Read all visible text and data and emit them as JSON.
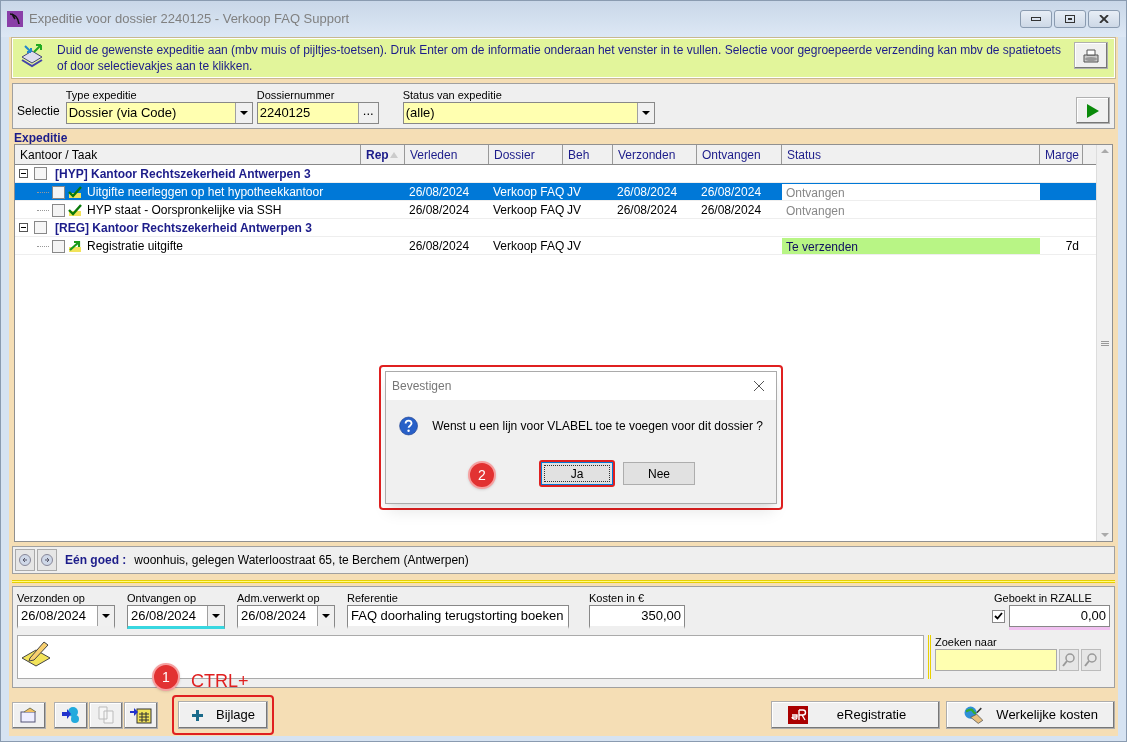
{
  "window": {
    "title": "Expeditie voor dossier 2240125 - Verkoop FAQ Support"
  },
  "info_bar": {
    "text": "Duid de gewenste expeditie aan (mbv muis of pijltjes-toetsen). Druk Enter om de informatie onderaan het venster in te vullen. Selectie voor gegroepeerde verzending kan mbv de spatietoets of door selectievakjes aan te klikken."
  },
  "selection": {
    "label": "Selectie",
    "fields": [
      {
        "label": "Type expeditie",
        "value": "Dossier (via Code)",
        "kind": "dropdown"
      },
      {
        "label": "Dossiernummer",
        "value": "2240125",
        "kind": "lookup",
        "button": "..."
      },
      {
        "label": "Status van expeditie",
        "value": "(alle)",
        "kind": "dropdown"
      }
    ]
  },
  "expeditie": {
    "title": "Expeditie",
    "columns": [
      "Kantoor / Taak",
      "Rep",
      "Verleden",
      "Dossier",
      "Beh",
      "Verzonden",
      "Ontvangen",
      "Status",
      "Marge"
    ],
    "groups": [
      {
        "label": "[HYP] Kantoor Rechtszekerheid Antwerpen 3",
        "expanded": true,
        "checked": false,
        "children": [
          {
            "label": "Uitgifte neerleggen op het hypotheekkantoor",
            "kind": "done",
            "checked": false,
            "selected": true,
            "verleden": "26/08/2024",
            "dossier": "Verkoop FAQ",
            "beh": "JV",
            "verzonden": "26/08/2024",
            "ontvangen": "26/08/2024",
            "status": {
              "text": "Ontvangen",
              "kind": "received"
            }
          },
          {
            "label": "HYP staat - Oorspronkelijke via SSH",
            "kind": "done",
            "checked": false,
            "selected": false,
            "verleden": "26/08/2024",
            "dossier": "Verkoop FAQ",
            "beh": "JV",
            "verzonden": "26/08/2024",
            "ontvangen": "26/08/2024",
            "status": {
              "text": "Ontvangen",
              "kind": "received"
            }
          }
        ]
      },
      {
        "label": "[REG] Kantoor Rechtszekerheid Antwerpen 3",
        "expanded": true,
        "checked": false,
        "children": [
          {
            "label": "Registratie uitgifte",
            "kind": "send",
            "checked": false,
            "selected": false,
            "verleden": "26/08/2024",
            "dossier": "Verkoop FAQ",
            "beh": "JV",
            "status": {
              "text": "Te verzenden",
              "kind": "to_send"
            },
            "marge": "7d"
          }
        ]
      }
    ]
  },
  "goed": {
    "label": "Eén goed :",
    "text": "woonhuis, gelegen Waterloostraat 65, te Berchem (Antwerpen)"
  },
  "details": {
    "fields": [
      {
        "label": "Verzonden op",
        "value": "26/08/2024",
        "kind": "date",
        "focused": false
      },
      {
        "label": "Ontvangen op",
        "value": "26/08/2024",
        "kind": "date",
        "focused": true
      },
      {
        "label": "Adm.verwerkt op",
        "value": "26/08/2024",
        "kind": "date",
        "focused": false
      },
      {
        "label": "Referentie",
        "value": "FAQ doorhaling terugstorting boeken",
        "kind": "text",
        "focused": false
      },
      {
        "label": "Kosten in €",
        "value": "350,00",
        "kind": "amount",
        "focused": false
      }
    ],
    "geboekt": {
      "label": "Geboekt in RZALLE",
      "checked": true,
      "value": "0,00"
    },
    "search": {
      "label": "Zoeken naar"
    }
  },
  "buttons": [
    {
      "label": "Bijlage",
      "kind": "plus"
    },
    {
      "label": "eRegistratie",
      "kind": "eregistratie"
    },
    {
      "label": "Werkelijke kosten",
      "kind": "costs"
    }
  ],
  "dialog": {
    "title": "Bevestigen",
    "message": "Wenst u een lijn voor VLABEL toe te voegen voor dit dossier ?",
    "buttons": [
      {
        "label": "Ja",
        "selected": true
      },
      {
        "label": "Nee",
        "selected": false
      }
    ]
  },
  "annotations": [
    {
      "kind": "step",
      "label": "1"
    },
    {
      "kind": "hint",
      "label": "CTRL+"
    },
    {
      "kind": "step",
      "label": "2"
    }
  ]
}
